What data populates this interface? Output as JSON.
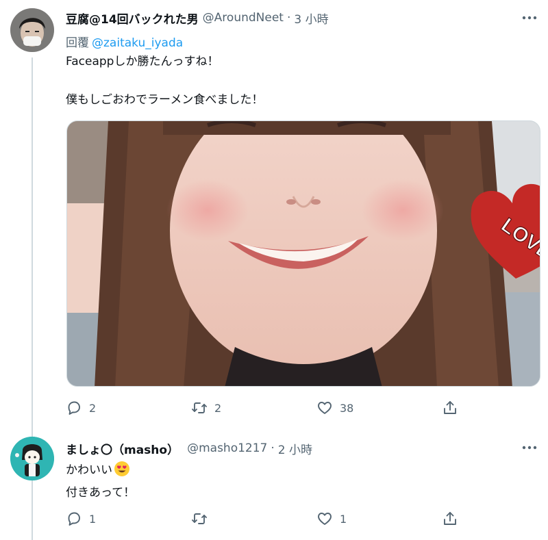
{
  "tweets": [
    {
      "display_name": "豆腐@14回バックれた男",
      "handle": "@AroundNeet",
      "separator": "·",
      "time": "3 小時",
      "reply_prefix": "回覆",
      "reply_to": "@zaitaku_iyada",
      "text_lines": [
        "Faceappしか勝たんっすね！",
        "",
        "僕もしごおわでラーメン食べました！"
      ],
      "media": {
        "type": "photo",
        "sticker_text": "LOVE"
      },
      "actions": {
        "reply_count": "2",
        "retweet_count": "2",
        "like_count": "38",
        "share_count": ""
      }
    },
    {
      "display_name": "ましょ〇（masho）",
      "handle": "@masho1217",
      "separator": "·",
      "time": "2 小時",
      "text_lines": [
        "かわいい",
        "付きあって！"
      ],
      "emoji": "smiling-face-with-heart-eyes",
      "actions": {
        "reply_count": "1",
        "retweet_count": "",
        "like_count": "1",
        "share_count": ""
      }
    }
  ],
  "colors": {
    "link": "#1d9bf0",
    "secondary_text": "#536471",
    "primary_text": "#0f1419",
    "border": "#cfd9de"
  },
  "icons": [
    "reply-icon",
    "retweet-icon",
    "like-icon",
    "share-icon",
    "more-icon"
  ]
}
